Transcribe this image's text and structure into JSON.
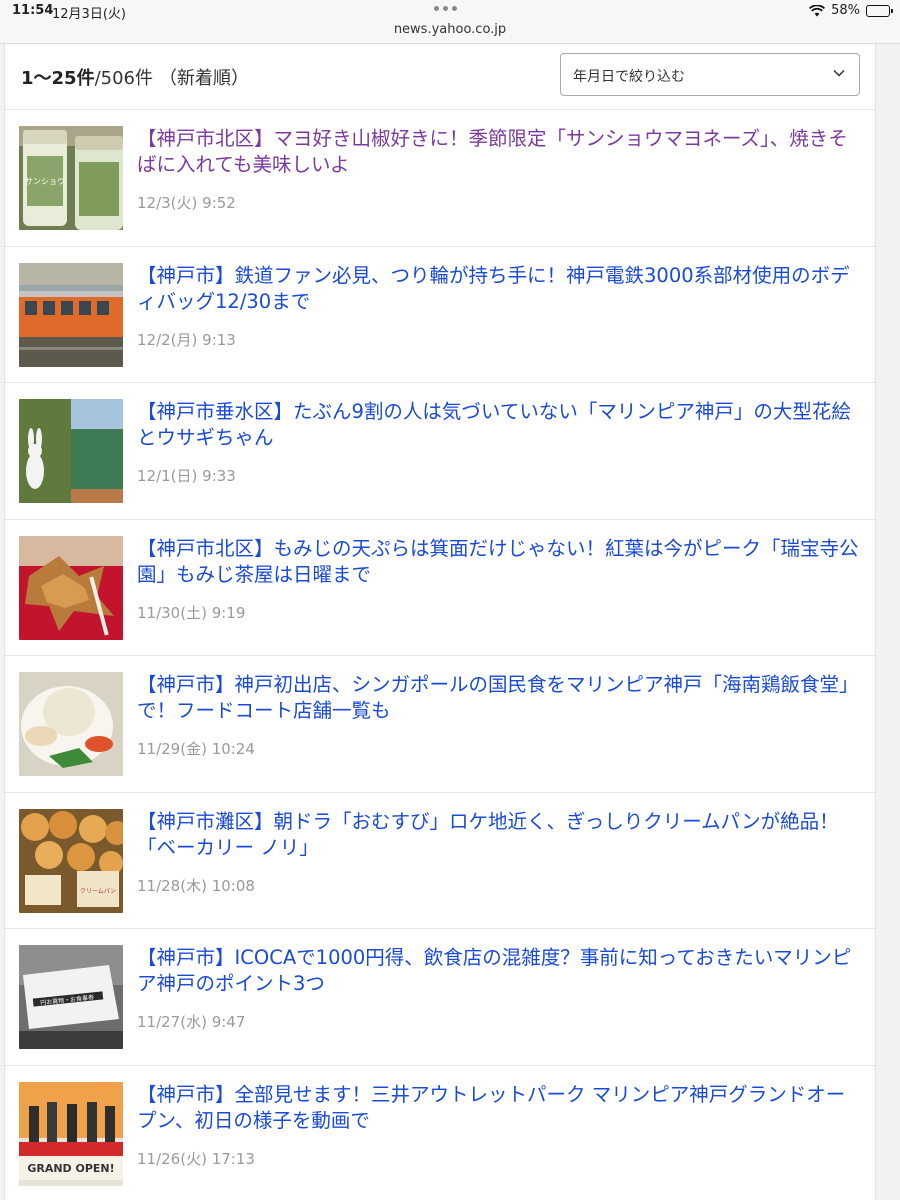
{
  "status_bar": {
    "time": "11:54",
    "date": "12月3日(火)",
    "battery": "58%",
    "battery_level": 0.58
  },
  "browser": {
    "url": "news.yahoo.co.jp"
  },
  "results": {
    "range": "1〜25件",
    "total": "/506件",
    "order": "（新着順）"
  },
  "filter": {
    "label": "年月日で絞り込む"
  },
  "articles": [
    {
      "title": "【神戸市北区】マヨ好き山椒好きに！季節限定「サンショウマヨネーズ」、焼きそばに入れても美味しいよ",
      "date": "12/3(火) 9:52",
      "visited": true
    },
    {
      "title": "【神戸市】鉄道ファン必見、つり輪が持ち手に！神戸電鉄3000系部材使用のボディバッグ12/30まで",
      "date": "12/2(月) 9:13",
      "visited": false
    },
    {
      "title": "【神戸市垂水区】たぶん9割の人は気づいていない「マリンピア神戸」の大型花絵とウサギちゃん",
      "date": "12/1(日) 9:33",
      "visited": false
    },
    {
      "title": "【神戸市北区】もみじの天ぷらは箕面だけじゃない！紅葉は今がピーク「瑞宝寺公園」もみじ茶屋は日曜まで",
      "date": "11/30(土) 9:19",
      "visited": false
    },
    {
      "title": "【神戸市】神戸初出店、シンガポールの国民食をマリンピア神戸「海南鶏飯食堂」で！フードコート店舗一覧も",
      "date": "11/29(金) 10:24",
      "visited": false
    },
    {
      "title": "【神戸市灘区】朝ドラ「おむすび」ロケ地近く、ぎっしりクリームパンが絶品！「ベーカリー ノリ」",
      "date": "11/28(木) 10:08",
      "visited": false
    },
    {
      "title": "【神戸市】ICOCAで1000円得、飲食店の混雑度？事前に知っておきたいマリンピア神戸のポイント3つ",
      "date": "11/27(水) 9:47",
      "visited": false
    },
    {
      "title": "【神戸市】全部見せます！三井アウトレットパーク マリンピア神戸グランドオープン、初日の様子を動画で",
      "date": "11/26(火) 17:13",
      "visited": false
    }
  ],
  "thumb_text": {
    "mayo_label": "サンショウ",
    "grand_open": "GRAND OPEN!",
    "cream_pan": "クリームパン",
    "shop_sign": "円お買物・お食事券"
  }
}
